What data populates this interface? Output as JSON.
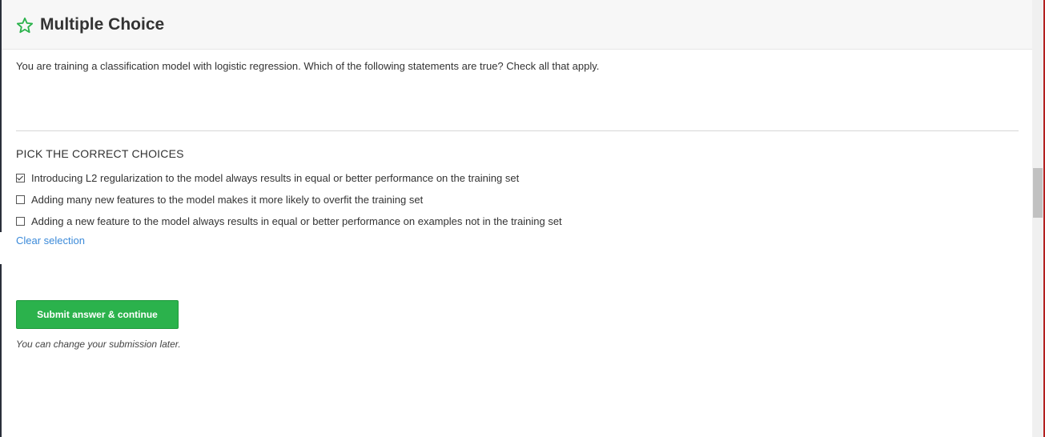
{
  "header": {
    "icon": "star-outline-icon",
    "title": "Multiple Choice"
  },
  "question": {
    "text": "You are training a classification model with logistic regression. Which of the following statements are true? Check all that apply."
  },
  "choices_section": {
    "heading": "PICK THE CORRECT CHOICES",
    "options": [
      {
        "label": "Introducing L2 regularization to the model always results in equal or better performance on the training set",
        "checked": true
      },
      {
        "label": "Adding many new features to the model makes it more likely to overfit the training set",
        "checked": false
      },
      {
        "label": "Adding a new feature to the model always results in equal or better performance on examples not in the training set",
        "checked": false
      }
    ],
    "clear_label": "Clear selection"
  },
  "submit": {
    "label": "Submit answer & continue",
    "note": "You can change your submission later."
  },
  "colors": {
    "accent_green": "#2bb24c",
    "link_blue": "#3b8ad9"
  }
}
